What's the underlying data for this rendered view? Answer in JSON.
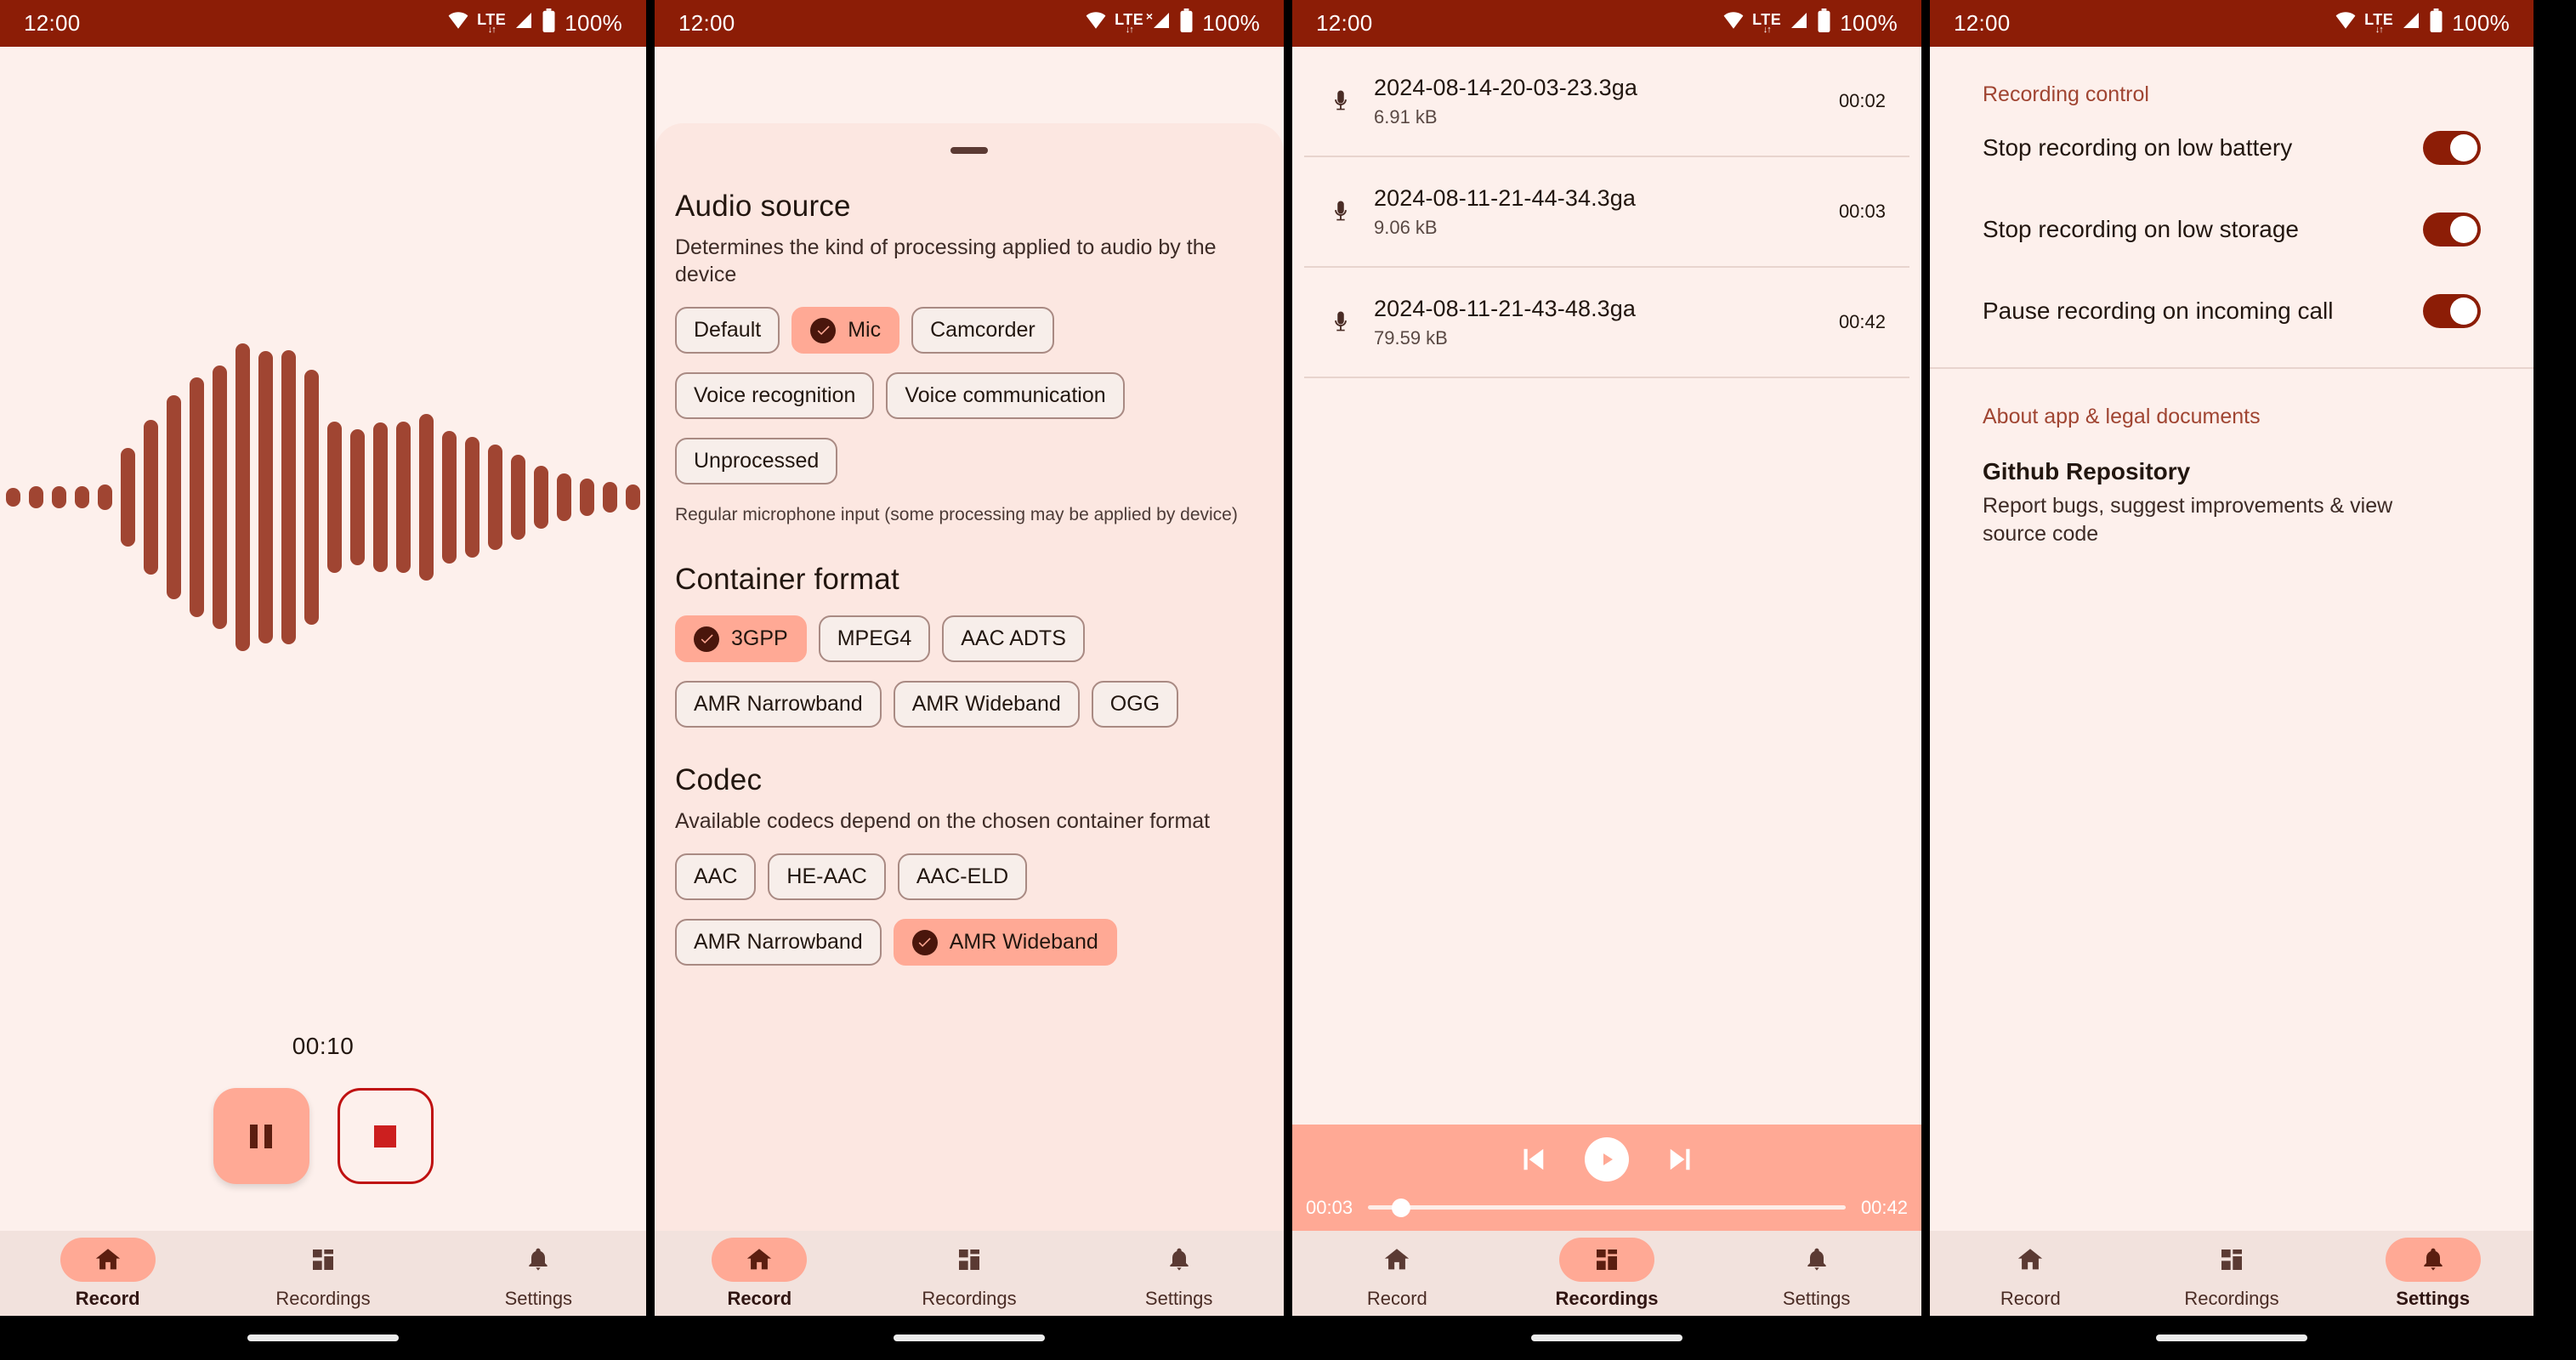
{
  "statusbar": {
    "time": "12:00",
    "battery": "100%",
    "network": "LTE",
    "wifi_icon": "wifi-icon",
    "signal_icon": "signal-icon",
    "battery_icon": "battery-icon"
  },
  "nav": {
    "record": "Record",
    "recordings": "Recordings",
    "settings": "Settings"
  },
  "screen_record": {
    "timer": "00:10",
    "pause_label": "Pause",
    "stop_label": "Stop",
    "waveform": [
      22,
      26,
      26,
      26,
      30,
      116,
      182,
      240,
      282,
      310,
      362,
      344,
      346,
      300,
      178,
      160,
      176,
      178,
      196,
      156,
      142,
      124,
      100,
      74,
      56,
      44,
      36,
      30
    ]
  },
  "screen_settings_sheet": {
    "audio_source": {
      "title": "Audio source",
      "subtitle": "Determines the kind of processing applied to audio by the device",
      "options": [
        "Default",
        "Mic",
        "Camcorder",
        "Voice recognition",
        "Voice communication",
        "Unprocessed"
      ],
      "selected": "Mic",
      "note": "Regular microphone input (some processing may be applied by device)"
    },
    "container_format": {
      "title": "Container format",
      "options": [
        "3GPP",
        "MPEG4",
        "AAC ADTS",
        "AMR Narrowband",
        "AMR Wideband",
        "OGG"
      ],
      "selected": "3GPP"
    },
    "codec": {
      "title": "Codec",
      "subtitle": "Available codecs depend on the chosen container format",
      "options": [
        "AAC",
        "HE-AAC",
        "AAC-ELD",
        "AMR Narrowband",
        "AMR Wideband"
      ],
      "selected": "AMR Wideband"
    }
  },
  "screen_recordings": {
    "items": [
      {
        "name": "2024-08-14-20-03-23.3ga",
        "size": "6.91 kB",
        "duration": "00:02"
      },
      {
        "name": "2024-08-11-21-44-34.3ga",
        "size": "9.06 kB",
        "duration": "00:03"
      },
      {
        "name": "2024-08-11-21-43-48.3ga",
        "size": "79.59 kB",
        "duration": "00:42"
      }
    ],
    "player": {
      "elapsed": "00:03",
      "total": "00:42",
      "progress_percent": 7,
      "prev_label": "Previous",
      "play_label": "Play",
      "next_label": "Next"
    }
  },
  "screen_settings": {
    "recording_control_header": "Recording control",
    "toggles": [
      {
        "label": "Stop recording on low battery",
        "on": true
      },
      {
        "label": "Stop recording on low storage",
        "on": true
      },
      {
        "label": "Pause recording on incoming call",
        "on": true
      }
    ],
    "about_header": "About app & legal documents",
    "about_item": {
      "title": "Github Repository",
      "subtitle": "Report bugs, suggest improvements & view source code"
    }
  },
  "colors": {
    "status_bar": "#8C1D06",
    "surface": "#FDF0EC",
    "sheet": "#FCE7E1",
    "accent": "#FFA995",
    "waveform": "#A04532",
    "nav_bg": "#F2E2DD",
    "stop_outline": "#BF1111"
  }
}
